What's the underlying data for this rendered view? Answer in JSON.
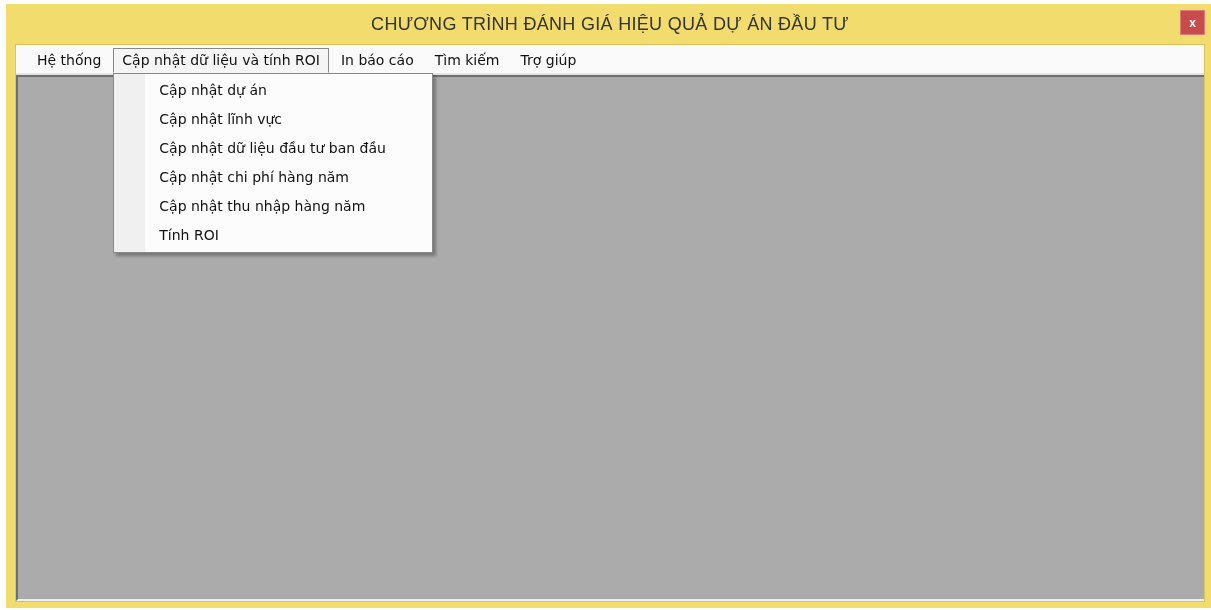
{
  "window": {
    "title": "CHƯƠNG TRÌNH ĐÁNH GIÁ HIỆU QUẢ DỰ ÁN ĐẦU TƯ",
    "close": "x"
  },
  "menu": [
    {
      "label": "Hệ thống",
      "selected": false
    },
    {
      "label": "Cập nhật dữ liệu và tính ROI",
      "selected": true
    },
    {
      "label": "In báo cáo",
      "selected": false
    },
    {
      "label": "Tìm kiếm",
      "selected": false
    },
    {
      "label": "Trợ giúp",
      "selected": false
    }
  ],
  "dropdown": {
    "items": [
      "Cập nhật dự án",
      "Cập nhật lĩnh vực",
      "Cập nhật dữ liệu đầu tư ban đầu",
      "Cập nhật chi phí hàng năm",
      "Cập nhật thu nhập hàng năm",
      "Tính ROI"
    ]
  }
}
